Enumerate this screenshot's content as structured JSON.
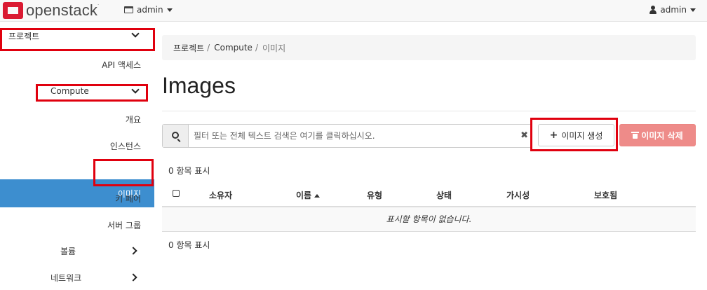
{
  "brand": {
    "name": "openstack",
    "mark": "."
  },
  "header": {
    "project_label": "admin",
    "user_label": "admin"
  },
  "sidebar": {
    "project": "프로젝트",
    "api_access": "API 액세스",
    "compute": "Compute",
    "compute_items": [
      "개요",
      "인스턴스",
      "이미지",
      "키 페어",
      "서버 그룹"
    ],
    "volumes": "볼륨",
    "network": "네트워크",
    "active_item": "이미지"
  },
  "breadcrumb": {
    "items": [
      "프로젝트",
      "Compute",
      "이미지"
    ],
    "separator": "/"
  },
  "page": {
    "title": "Images"
  },
  "filter": {
    "placeholder": "필터 또는 전체 텍스트 검색은 여기를 클릭하십시오.",
    "value": "",
    "clear": "✖"
  },
  "actions": {
    "create": "이미지 생성",
    "delete": "이미지 삭제"
  },
  "table": {
    "count_top": "0 항목 표시",
    "count_bottom": "0 항목 표시",
    "headers": [
      "소유자",
      "이름",
      "유형",
      "상태",
      "가시성",
      "보호됨"
    ],
    "sorted_column": "이름",
    "empty_message": "표시할 항목이 없습니다."
  },
  "colors": {
    "active_sidebar": "#3d8ecf",
    "brand_red": "#da1a32",
    "highlight_box": "#e0000e",
    "delete_button": "#ee8b89"
  }
}
